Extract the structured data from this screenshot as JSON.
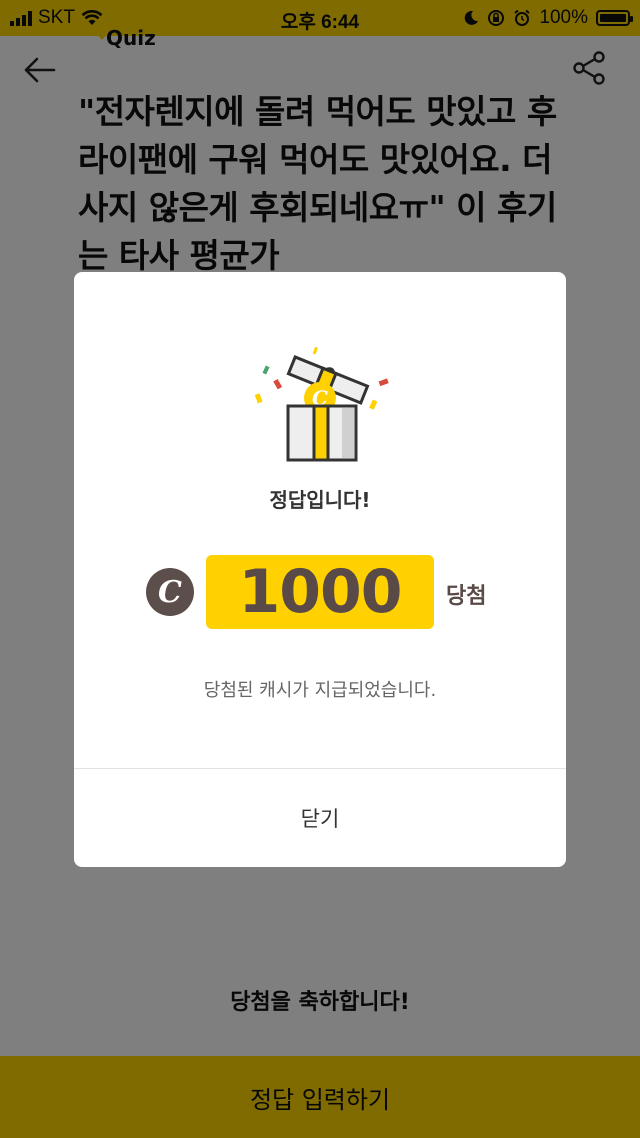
{
  "status_bar": {
    "carrier": "SKT",
    "time": "오후 6:44",
    "battery": "100%"
  },
  "header": {
    "tag": "Quiz"
  },
  "question": {
    "text": "\"전자렌지에 돌려 먹어도 맛있고 후라이팬에 구워 먹어도 맛있어요. 더 사지 않은게 후회되네요ㅠ\" 이 후기는 타사 평균가"
  },
  "bottom": {
    "congrats": "당첨을 축하합니다!",
    "submit_label": "정답 입력하기"
  },
  "modal": {
    "coin_symbol": "C",
    "title": "정답입니다!",
    "amount": "1000",
    "win_label": "당첨",
    "message": "당첨된 캐시가 지급되었습니다.",
    "close_label": "닫기"
  },
  "colors": {
    "accent": "#ffd600",
    "coin": "#5c4e4b"
  }
}
